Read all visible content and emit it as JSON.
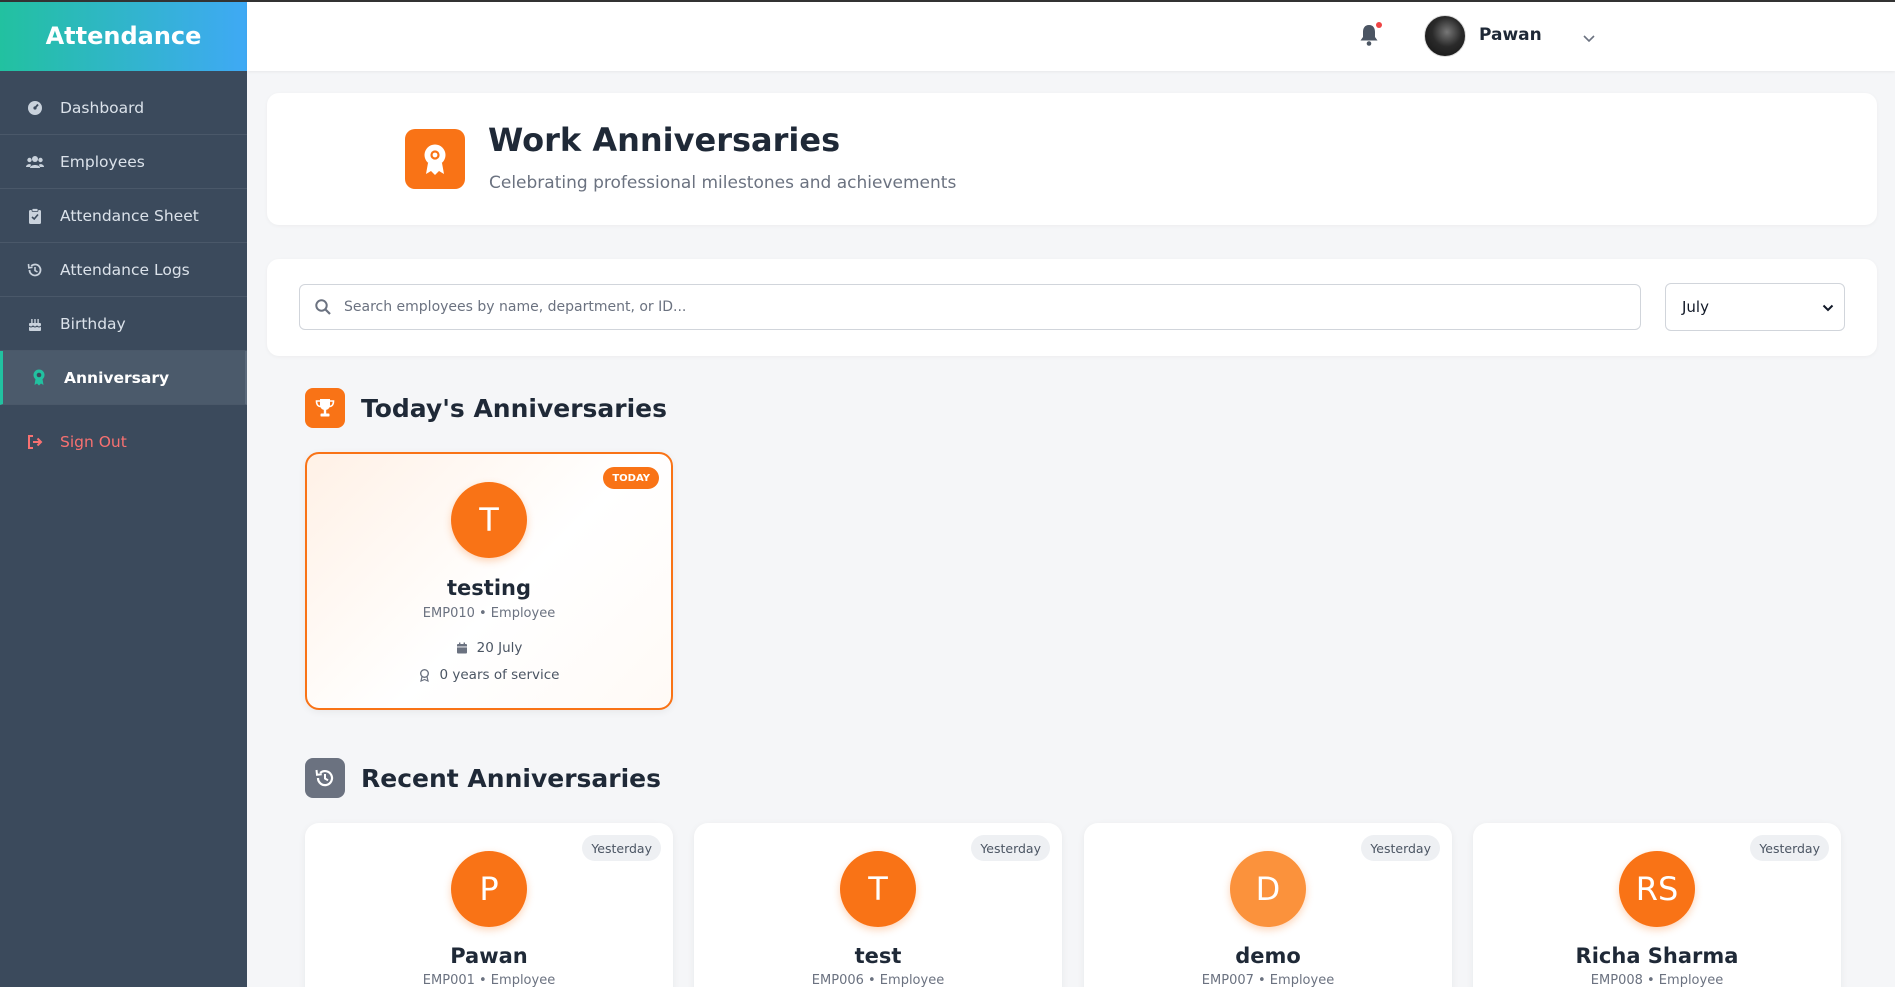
{
  "app": {
    "title": "Attendance"
  },
  "sidebar": {
    "items": [
      {
        "label": "Dashboard",
        "icon": "dashboard-icon"
      },
      {
        "label": "Employees",
        "icon": "users-icon"
      },
      {
        "label": "Attendance Sheet",
        "icon": "clipboard-icon"
      },
      {
        "label": "Attendance Logs",
        "icon": "history-icon"
      },
      {
        "label": "Birthday",
        "icon": "cake-icon"
      },
      {
        "label": "Anniversary",
        "icon": "award-icon",
        "active": true
      }
    ],
    "signout": "Sign Out"
  },
  "header": {
    "username": "Pawan",
    "notification_dot": true
  },
  "hero": {
    "title": "Work Anniversaries",
    "subtitle": "Celebrating professional milestones and achievements"
  },
  "filter": {
    "search_placeholder": "Search employees by name, department, or ID...",
    "month": "July"
  },
  "today": {
    "heading": "Today's Anniversaries",
    "cards": [
      {
        "initials": "T",
        "name": "testing",
        "meta": "EMP010 • Employee",
        "date": "20 July",
        "service": "0 years of service",
        "badge": "TODAY"
      }
    ]
  },
  "recent": {
    "heading": "Recent Anniversaries",
    "cards": [
      {
        "initials": "P",
        "name": "Pawan",
        "meta": "EMP001 • Employee",
        "badge": "Yesterday"
      },
      {
        "initials": "T",
        "name": "test",
        "meta": "EMP006 • Employee",
        "badge": "Yesterday"
      },
      {
        "initials": "D",
        "name": "demo",
        "meta": "EMP007 • Employee",
        "badge": "Yesterday"
      },
      {
        "initials": "RS",
        "name": "Richa Sharma",
        "meta": "EMP008 • Employee",
        "badge": "Yesterday"
      }
    ]
  },
  "colors": {
    "accent": "#f97316",
    "sidebar": "#3b4a5c",
    "brand_from": "#22c1a0",
    "brand_to": "#3fa9f5",
    "signout": "#f87171"
  }
}
